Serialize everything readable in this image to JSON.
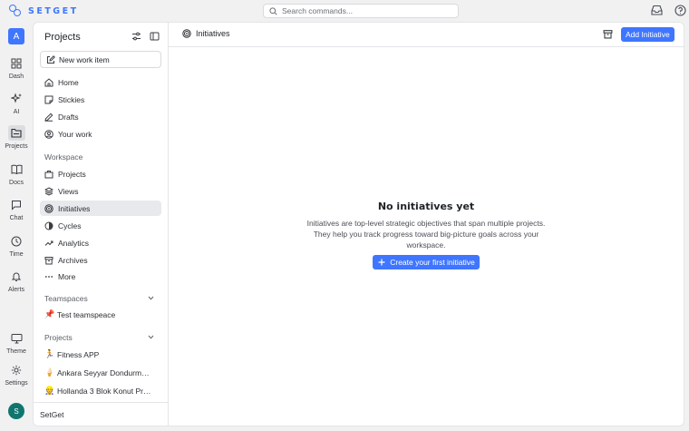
{
  "app": {
    "brand": "SETGET",
    "accent": "#3f76ff"
  },
  "search": {
    "placeholder": "Search commands..."
  },
  "rail": {
    "workspace_initial": "A",
    "items": [
      {
        "label": "Dash",
        "icon": "dashboard-icon"
      },
      {
        "label": "AI",
        "icon": "sparkles-icon"
      },
      {
        "label": "Projects",
        "icon": "folder-icon",
        "active": true
      },
      {
        "label": "Docs",
        "icon": "book-icon"
      },
      {
        "label": "Chat",
        "icon": "chat-icon"
      },
      {
        "label": "Time",
        "icon": "clock-icon"
      },
      {
        "label": "Alerts",
        "icon": "bell-icon"
      },
      {
        "label": "Theme",
        "icon": "monitor-icon"
      },
      {
        "label": "Settings",
        "icon": "gear-icon"
      }
    ],
    "user_initial": "S"
  },
  "sidebar": {
    "title": "Projects",
    "new_item": "New work item",
    "main_nav": [
      {
        "label": "Home",
        "icon": "home-icon"
      },
      {
        "label": "Stickies",
        "icon": "sticky-note-icon"
      },
      {
        "label": "Drafts",
        "icon": "pencil-icon"
      },
      {
        "label": "Your work",
        "icon": "user-circle-icon"
      }
    ],
    "workspace_label": "Workspace",
    "workspace_nav": [
      {
        "label": "Projects",
        "icon": "briefcase-icon"
      },
      {
        "label": "Views",
        "icon": "layers-icon"
      },
      {
        "label": "Initiatives",
        "icon": "target-icon",
        "active": true
      },
      {
        "label": "Cycles",
        "icon": "cycle-icon"
      },
      {
        "label": "Analytics",
        "icon": "trend-icon"
      },
      {
        "label": "Archives",
        "icon": "archive-icon"
      },
      {
        "label": "More",
        "icon": "ellipsis-icon"
      }
    ],
    "teamspaces_label": "Teamspaces",
    "teamspaces": [
      {
        "label": "Test teamspeace",
        "emoji": "📌"
      }
    ],
    "projects_label": "Projects",
    "projects": [
      {
        "label": "Fitness APP",
        "emoji": "🏃"
      },
      {
        "label": "Ankara Seyyar Dondurm…",
        "emoji": "🍦"
      },
      {
        "label": "Hollanda 3 Blok Konut Pr…",
        "emoji": "👷"
      }
    ],
    "footer": "SetGet"
  },
  "main": {
    "breadcrumb": "Initiatives",
    "add_button": "Add Initiative",
    "empty_title": "No initiatives yet",
    "empty_description": "Initiatives are top-level strategic objectives that span multiple projects. They help you track progress toward big-picture goals across your workspace.",
    "create_button": "Create your first initiative"
  }
}
